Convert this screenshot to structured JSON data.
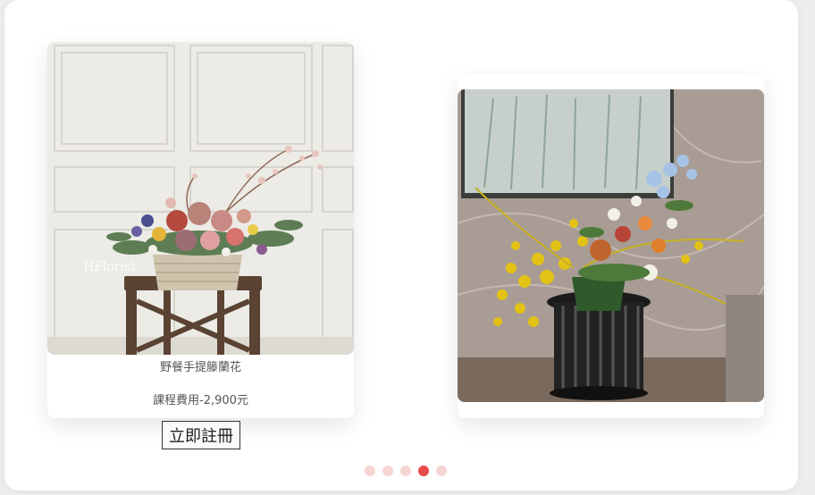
{
  "cards": [
    {
      "image_alt": "Picnic handheld rattan basket flower arrangement",
      "logo_text": "HFlorist",
      "title": "野餐手提籐蘭花",
      "price": "課程費用-2,900元",
      "button_label": "立即註冊"
    },
    {
      "image_alt": "Large yellow orchid floral arrangement on black stand"
    }
  ],
  "carousel": {
    "dots": [
      {
        "active": false
      },
      {
        "active": false
      },
      {
        "active": false
      },
      {
        "active": true
      },
      {
        "active": false
      }
    ]
  },
  "colors": {
    "active_dot": "#e84a4a",
    "inactive_dot": "#f6d5d5"
  }
}
